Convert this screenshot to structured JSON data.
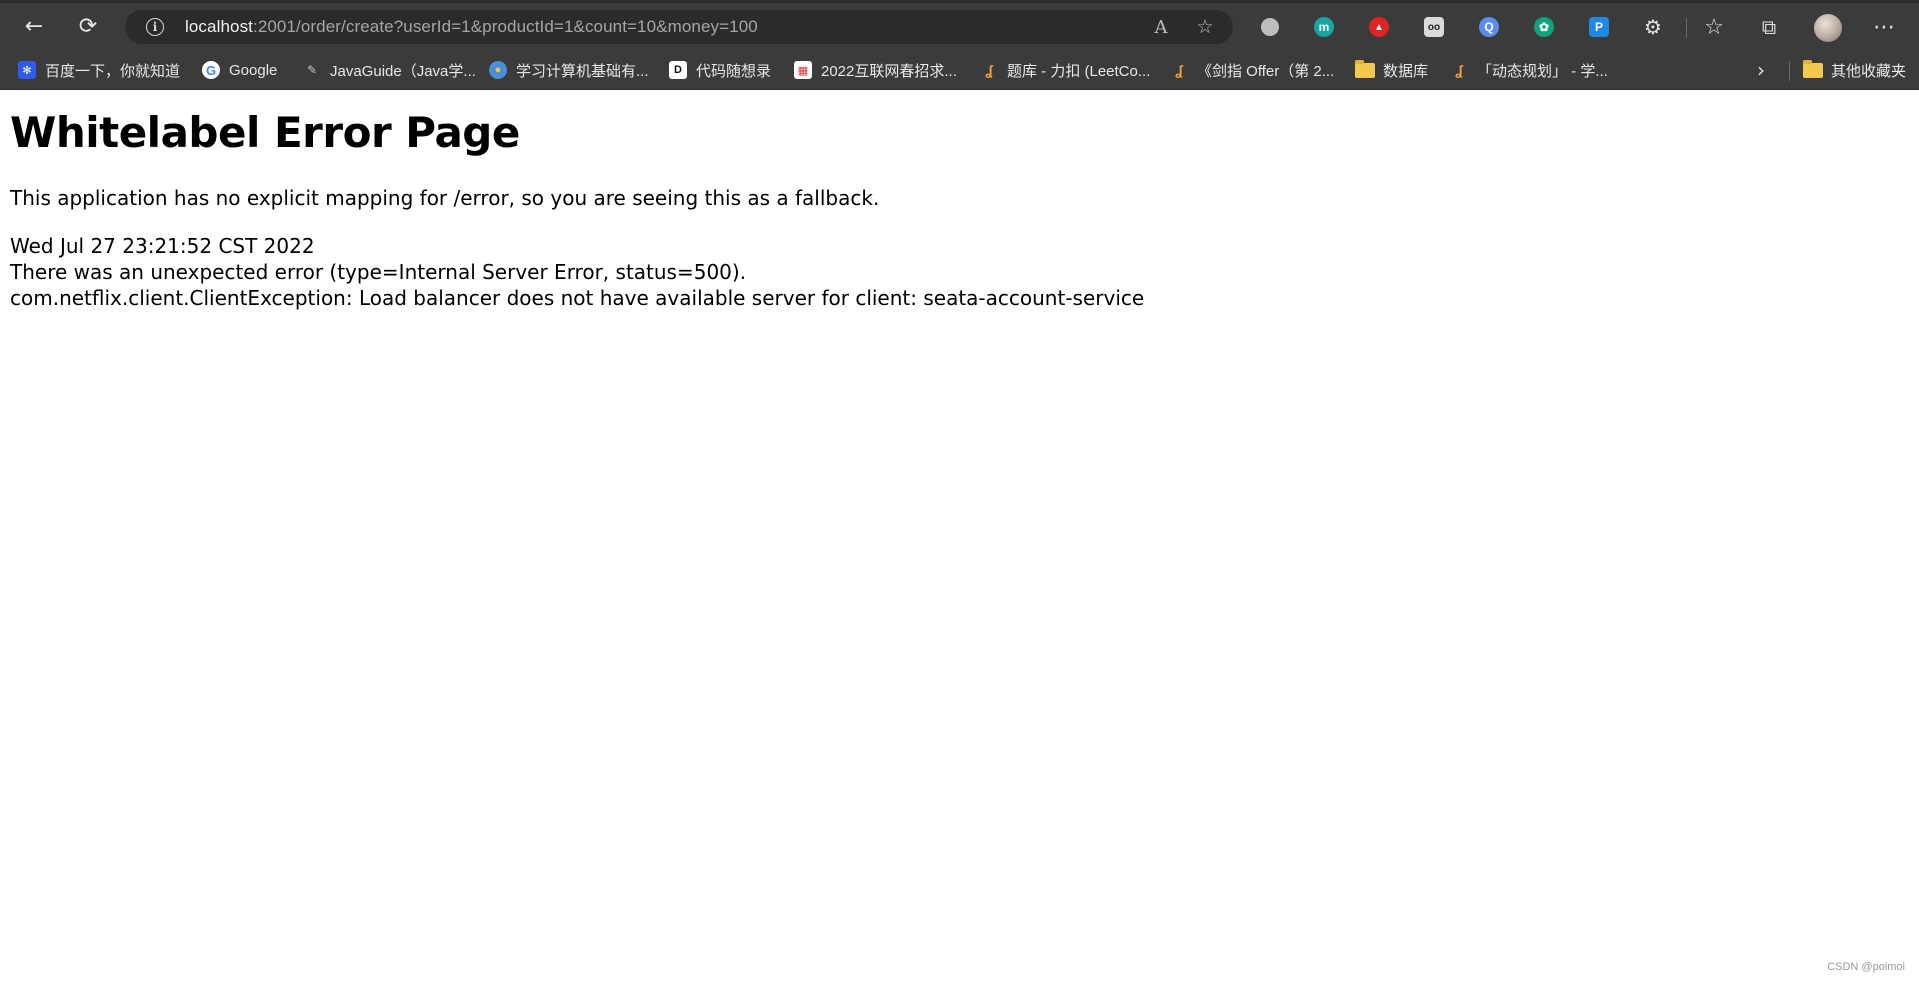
{
  "browser": {
    "url_host": "localhost",
    "url_rest": ":2001/order/create?userId=1&productId=1&count=10&money=100",
    "icons": {
      "back": "←",
      "reload": "⟳",
      "info": "i",
      "read_aloud": "A",
      "add_favorite": "☆",
      "extensions": "⚙",
      "favorites": "☆",
      "collections": "⧉",
      "more": "⋯"
    },
    "extensions": [
      {
        "name": "circle-extension",
        "color": "#bdbdbd",
        "glyph": ""
      },
      {
        "name": "m-extension",
        "color": "#17a6a0",
        "glyph": "m"
      },
      {
        "name": "lock-extension",
        "color": "#e02424",
        "glyph": "🔒"
      },
      {
        "name": "tampermonkey-extension",
        "color": "#2a2a2a",
        "glyph": "oo"
      },
      {
        "name": "search-extension",
        "color": "#5b8def",
        "glyph": "Q"
      },
      {
        "name": "chatgpt-extension",
        "color": "#10a37f",
        "glyph": "✿"
      },
      {
        "name": "p-extension",
        "color": "#1e88e5",
        "glyph": "P"
      }
    ]
  },
  "bookmarks": [
    {
      "label": "百度一下，你就知道",
      "icon": "baidu-icon"
    },
    {
      "label": "Google",
      "icon": "google-icon"
    },
    {
      "label": "JavaGuide（Java学...",
      "icon": "javaguide-icon"
    },
    {
      "label": "学习计算机基础有...",
      "icon": "globe-icon"
    },
    {
      "label": "代码随想录",
      "icon": "d-icon"
    },
    {
      "label": "2022互联网春招求...",
      "icon": "calendar-icon"
    },
    {
      "label": "题库 - 力扣 (LeetCo...",
      "icon": "leetcode-icon"
    },
    {
      "label": "《剑指 Offer（第 2...",
      "icon": "leetcode-icon"
    },
    {
      "label": "数据库",
      "icon": "folder-icon"
    },
    {
      "label": "「动态规划」 - 学...",
      "icon": "leetcode-icon"
    }
  ],
  "other_bookmarks": "其他收藏夹",
  "page": {
    "title": "Whitelabel Error Page",
    "message": "This application has no explicit mapping for /error, so you are seeing this as a fallback.",
    "timestamp": "Wed Jul 27 23:21:52 CST 2022",
    "error_line": "There was an unexpected error (type=Internal Server Error, status=500).",
    "exception_line": "com.netflix.client.ClientException: Load balancer does not have available server for client: seata-account-service"
  },
  "watermark": "CSDN @poimoi"
}
